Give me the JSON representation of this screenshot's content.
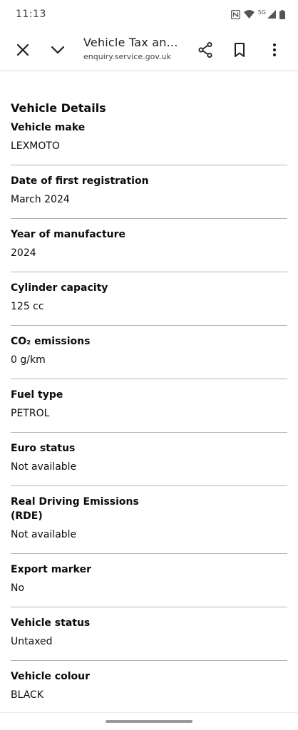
{
  "status_bar": {
    "time": "11:13",
    "network_label": "5G",
    "icons": [
      "nfc-icon",
      "wifi-icon",
      "signal-icon",
      "battery-icon"
    ]
  },
  "browser_toolbar": {
    "page_title": "Vehicle Tax and ...",
    "url": "enquiry.service.gov.uk",
    "icons": [
      "close-icon",
      "chevron-down-icon",
      "share-icon",
      "bookmark-icon",
      "more-vert-icon"
    ]
  },
  "vehicle_details": {
    "heading": "Vehicle Details",
    "rows": [
      {
        "label": "Vehicle make",
        "value": "LEXMOTO"
      },
      {
        "label": "Date of first registration",
        "value": "March 2024"
      },
      {
        "label": "Year of manufacture",
        "value": "2024"
      },
      {
        "label": "Cylinder capacity",
        "value": "125 cc"
      },
      {
        "label": "CO₂ emissions",
        "value": "0 g/km"
      },
      {
        "label": "Fuel type",
        "value": "PETROL"
      },
      {
        "label": "Euro status",
        "value": "Not available"
      },
      {
        "label": "Real Driving Emissions (RDE)",
        "value": "Not available"
      },
      {
        "label": "Export marker",
        "value": "No"
      },
      {
        "label": "Vehicle status",
        "value": "Untaxed"
      },
      {
        "label": "Vehicle colour",
        "value": "BLACK"
      }
    ]
  }
}
